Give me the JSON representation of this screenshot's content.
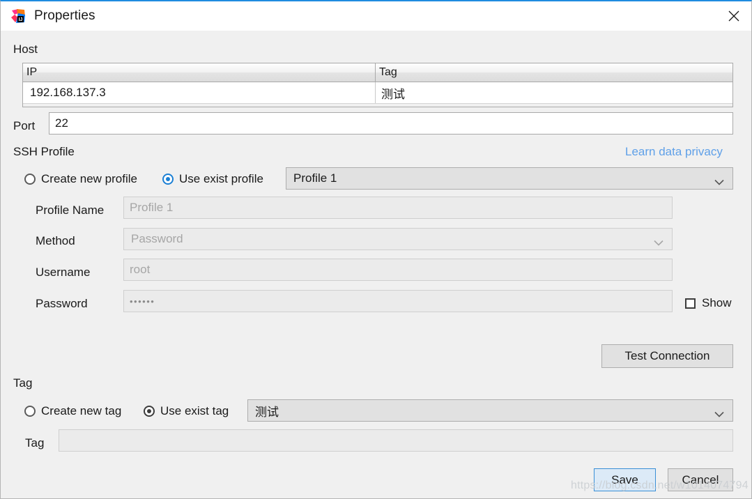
{
  "window": {
    "title": "Properties",
    "app_icon": "intellij-idea-icon",
    "close_icon": "close-icon",
    "accent_color": "#1f8ce0"
  },
  "host": {
    "section_label": "Host",
    "columns": [
      "IP",
      "Tag"
    ],
    "rows": [
      {
        "ip": "192.168.137.3",
        "tag": "测试"
      }
    ]
  },
  "port": {
    "label": "Port",
    "value": "22"
  },
  "ssh_profile": {
    "section_label": "SSH Profile",
    "privacy_link": "Learn data privacy",
    "privacy_link_color": "#5fa0e8",
    "radios": [
      {
        "label": "Create new profile",
        "selected": false
      },
      {
        "label": "Use exist profile",
        "selected": true
      }
    ],
    "profile_select": {
      "value": "Profile 1",
      "chevron_icon": "chevron-down-icon"
    },
    "fields": {
      "profile_name": {
        "label": "Profile Name",
        "value": "Profile 1",
        "disabled": true
      },
      "method": {
        "label": "Method",
        "value": "Password",
        "disabled": true,
        "chevron_icon": "chevron-down-icon"
      },
      "username": {
        "label": "Username",
        "value": "root",
        "disabled": true
      },
      "password": {
        "label": "Password",
        "value": "••••••",
        "disabled": true
      }
    },
    "show_password": {
      "label": "Show",
      "checked": false
    },
    "test_button": "Test Connection"
  },
  "tag": {
    "section_label": "Tag",
    "radios": [
      {
        "label": "Create new tag",
        "selected": false
      },
      {
        "label": "Use exist tag",
        "selected": true
      }
    ],
    "tag_select": {
      "value": "测试",
      "chevron_icon": "chevron-down-icon"
    },
    "tag_field": {
      "label": "Tag",
      "value": "",
      "disabled": true
    }
  },
  "footer": {
    "save_label": "Save",
    "cancel_label": "Cancel"
  },
  "watermark": "https://blog.csdn.net/w1014074794"
}
